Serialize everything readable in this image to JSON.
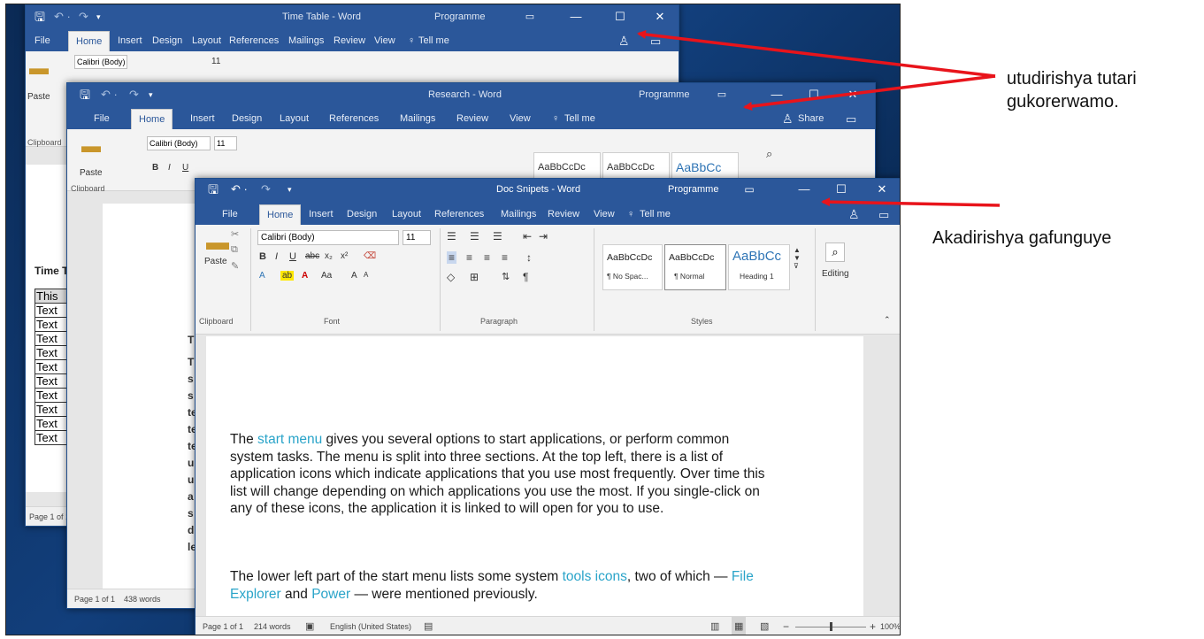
{
  "window_back": {
    "title": "Time Table - Word",
    "account": "Programme",
    "tabs": [
      "File",
      "Home",
      "Insert",
      "Design",
      "Layout",
      "References",
      "Mailings",
      "Review",
      "View"
    ],
    "tell_me": "Tell me",
    "font_name": "Calibri (Body)",
    "font_size": "11",
    "paste_label": "Paste",
    "clipboard_label": "Clipboard",
    "doc_heading": "Time T",
    "table_first": "This",
    "table_rows": [
      "Text",
      "Text",
      "Text",
      "Text",
      "Text",
      "Text",
      "Text",
      "Text",
      "Text",
      "Text"
    ],
    "status": "Page 1 of 1"
  },
  "window_middle": {
    "title": "Research - Word",
    "account": "Programme",
    "tabs": [
      "File",
      "Home",
      "Insert",
      "Design",
      "Layout",
      "References",
      "Mailings",
      "Review",
      "View"
    ],
    "tell_me": "Tell me",
    "share": "Share",
    "font_name": "Calibri (Body)",
    "font_size": "11",
    "paste_label": "Paste",
    "clipboard_label": "Clipboard",
    "style1": "AaBbCcDc",
    "style2": "AaBbCcDc",
    "style3": "AaBbCc",
    "fragments": [
      "Tl",
      "Tl",
      "s",
      "s",
      "te",
      "te",
      "te",
      "u",
      "u",
      "a",
      "s",
      "d",
      "le"
    ],
    "status_page": "Page 1 of 1",
    "status_words": "438 words"
  },
  "window_front": {
    "title": "Doc Snipets - Word",
    "account": "Programme",
    "tabs": [
      "File",
      "Home",
      "Insert",
      "Design",
      "Layout",
      "References",
      "Mailings",
      "Review",
      "View"
    ],
    "tell_me": "Tell me",
    "font_name": "Calibri (Body)",
    "font_size": "11",
    "paste_label": "Paste",
    "groups": {
      "clipboard": "Clipboard",
      "font": "Font",
      "paragraph": "Paragraph",
      "styles": "Styles"
    },
    "styles": [
      {
        "sample": "AaBbCcDc",
        "name": "¶ No Spac..."
      },
      {
        "sample": "AaBbCcDc",
        "name": "¶ Normal"
      },
      {
        "sample": "AaBbCc",
        "name": "Heading 1"
      }
    ],
    "editing": "Editing",
    "doc": {
      "p1_a": "The ",
      "p1_link": "start menu",
      "p1_b": " gives you several options to start applications, or perform common system tasks.  The menu is split into three sections.  At the top left, there is a list of application icons which indicate applications that you use most frequently.  Over time this list will change depending on which applications you use the most.  If you single-click on any of these icons, the application it is linked to will open for you to use.",
      "p2_a": "The lower left part of the start menu lists some system ",
      "p2_link1": "tools icons",
      "p2_b": ", two of which — ",
      "p2_link2": "File Explorer",
      "p2_c": " and ",
      "p2_link3": "Power",
      "p2_d": " — were mentioned previously."
    },
    "status": {
      "page": "Page 1 of 1",
      "words": "214 words",
      "language": "English (United States)",
      "zoom": "100%"
    }
  },
  "annotations": {
    "top": "utudirishya tutari",
    "top_line2": "gukorerwamo.",
    "bottom": "Akadirishya gafunguye",
    "arrow_color": "#e8141b"
  }
}
